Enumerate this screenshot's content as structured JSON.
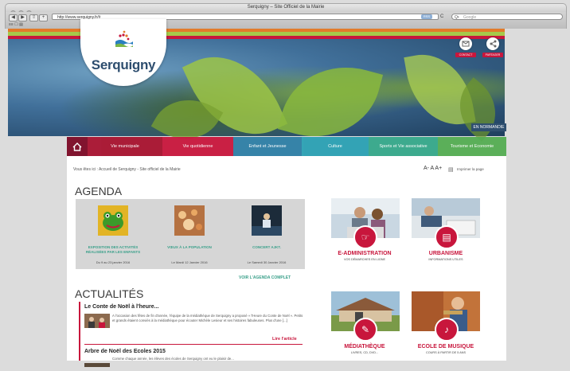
{
  "browser": {
    "window_title": "Serquigny – Site Officiel de la Mairie",
    "url": "http://www.serquigny.fr/#",
    "search_placeholder": "Google",
    "search_prefix": "Q•",
    "rss": "RSS",
    "reload": "C",
    "back": "◀",
    "forward": "▶",
    "add": "+",
    "bookmarks": "≡≡ ☐ ▤"
  },
  "header": {
    "logo_text": "Serquigny",
    "contact_label": "CONTACT",
    "partager_label": "PARTAGER",
    "normandie_badge": "EN NORMANDIE"
  },
  "nav": {
    "home_icon": "home-icon",
    "items": [
      {
        "label": "Vie municipale",
        "color": "#a8122f"
      },
      {
        "label": "Vie quotidienne",
        "color": "#c8163c"
      },
      {
        "label": "Enfant et Jeunesse",
        "color": "#2e7fa6"
      },
      {
        "label": "Culture",
        "color": "#2aa1b3"
      },
      {
        "label": "Sports et Vie associative",
        "color": "#35a88a"
      },
      {
        "label": "Tourisme et Economie",
        "color": "#55ad52"
      }
    ]
  },
  "breadcrumb": "Vous êtes ici : Accueil de Serquigny - Site officiel de la Mairie",
  "font_controls": "A- A A+",
  "print_label": "Imprimer la page",
  "agenda": {
    "heading": "AGENDA",
    "events": [
      {
        "title": "EXPOSITION DES ACTIVITÉS RÉALISÉES PAR LES ENFANTS",
        "date": "Du 9 au 23 janvier 2016"
      },
      {
        "title": "VŒUX À LA POPULATION",
        "date": "Le Mardi 12 Janvier 2016"
      },
      {
        "title": "CONCERT AJKT.",
        "date": "Le Samedi 30 Janvier 2016"
      }
    ],
    "full_link": "VOIR L'AGENDA COMPLET"
  },
  "actualites": {
    "heading": "ACTUALITÉS",
    "items": [
      {
        "title": "Le Conte de Noël à l'heure...",
        "text": "A l'occasion des fêtes de fin d'année, l'équipe de la médiathèque de Serquigny a proposé « l'Heure du Conte de Noël ». Petits et grands étaient conviés à la médiathèque pour écouter Michèle Lesieur et ses histoires fabuleuses. Plus d'une [...]",
        "read_more": "Lire l'article"
      },
      {
        "title": "Arbre de Noël des Ecoles 2015",
        "text": "Comme chaque année, les élèves des écoles de Serquigny ont eu le plaisir de...",
        "read_more": ""
      }
    ]
  },
  "tiles": [
    {
      "name": "E-ADMINISTRATION",
      "sub": "VOS DÉMARCHES EN LIGNE",
      "icon": "pointer-hand-icon"
    },
    {
      "name": "URBANISME",
      "sub": "INFORMATIONS UTILES",
      "icon": "map-icon"
    },
    {
      "name": "MÉDIATHÈQUE",
      "sub": "LIVRES, CD, DVD...",
      "icon": "book-icon"
    },
    {
      "name": "ECOLE DE MUSIQUE",
      "sub": "COURS À PARTIR DE 5 ANS",
      "icon": "music-note-icon"
    }
  ]
}
